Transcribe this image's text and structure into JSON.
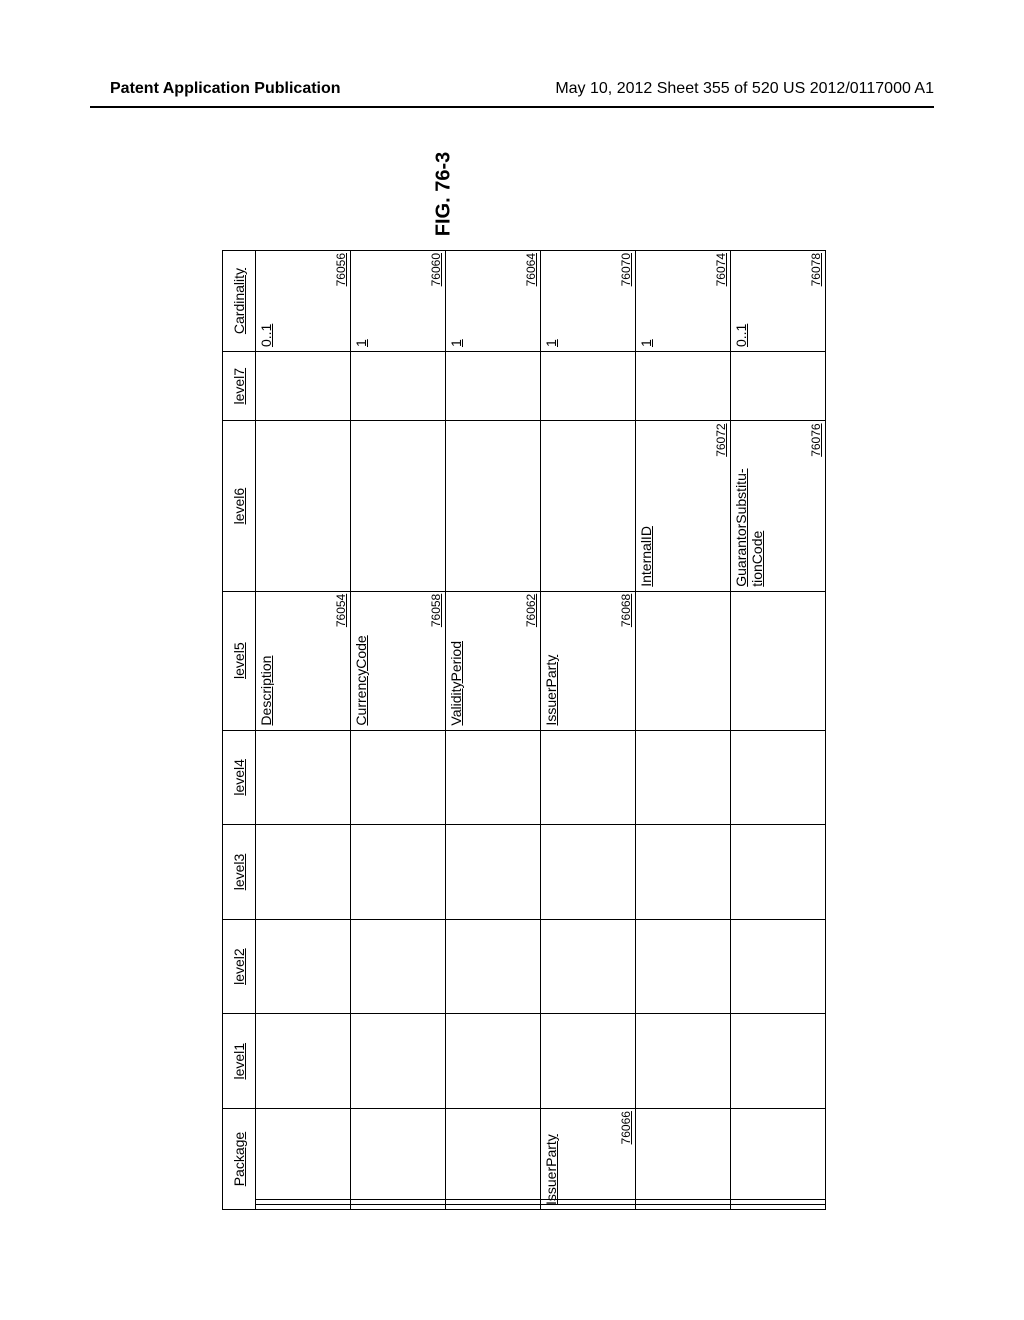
{
  "header": {
    "left": "Patent Application Publication",
    "right": "May 10, 2012  Sheet 355 of 520   US 2012/0117000 A1"
  },
  "figure_label": "FIG. 76-3",
  "table": {
    "columns": [
      "Package",
      "level1",
      "level2",
      "level3",
      "level4",
      "level5",
      "level6",
      "level7",
      "Cardinality"
    ],
    "rows": [
      {
        "package": "",
        "level5": "Description",
        "ref5": "76054",
        "level6": "",
        "ref6": "",
        "cardinality": "0..1",
        "refC": "76056"
      },
      {
        "package": "",
        "level5": "CurrencyCode",
        "ref5": "76058",
        "level6": "",
        "ref6": "",
        "cardinality": "1",
        "refC": "76060"
      },
      {
        "package": "",
        "level5": "ValidityPeriod",
        "ref5": "76062",
        "level6": "",
        "ref6": "",
        "cardinality": "1",
        "refC": "76064"
      },
      {
        "package": "IssuerParty",
        "packageRef": "76066",
        "level5": "IssuerParty",
        "ref5": "76068",
        "level6": "",
        "ref6": "",
        "cardinality": "1",
        "refC": "76070"
      },
      {
        "package": "",
        "level5": "",
        "ref5": "",
        "level6": "InternalID",
        "ref6": "76072",
        "cardinality": "1",
        "refC": "76074"
      },
      {
        "package": "",
        "level5": "",
        "ref5": "",
        "level6": "GuarantorSubstitu-tionCode",
        "ref6": "76076",
        "cardinality": "0..1",
        "refC": "76078"
      }
    ]
  }
}
